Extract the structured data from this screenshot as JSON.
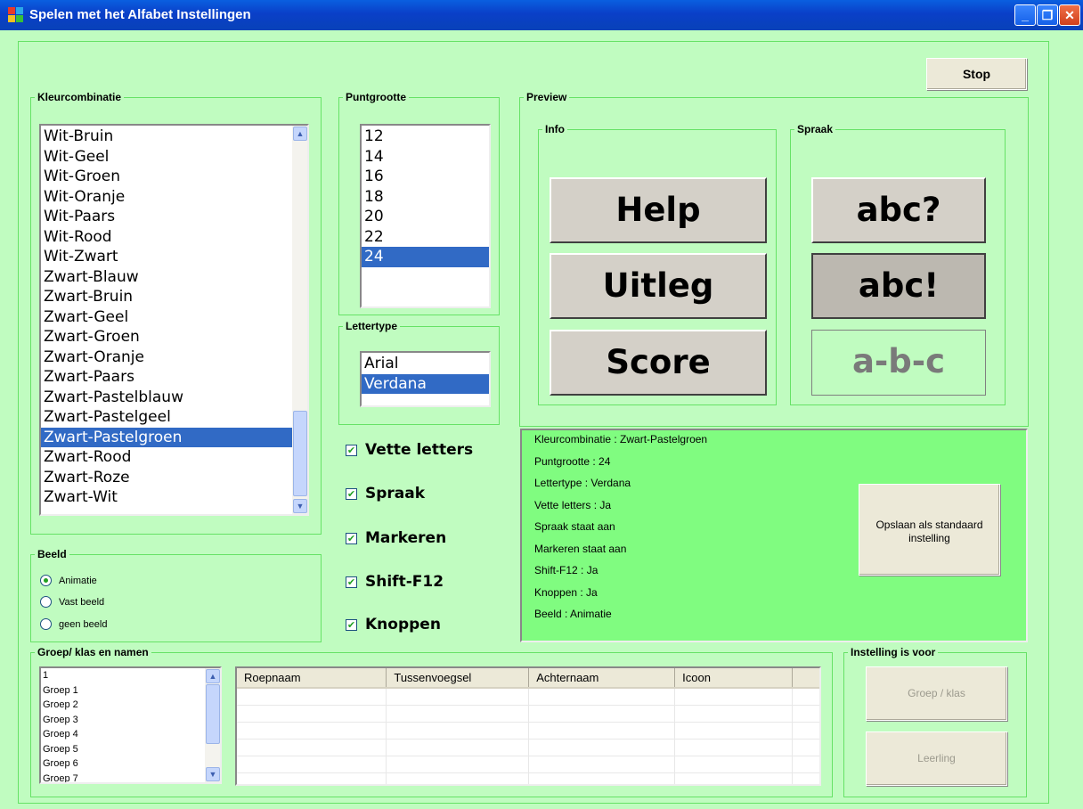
{
  "window": {
    "title": "Spelen met het Alfabet Instellingen",
    "controls": {
      "minimize": "_",
      "restore": "❐",
      "close": "✕"
    }
  },
  "stop_button": "Stop",
  "kleur": {
    "legend": "Kleurcombinatie",
    "items": [
      "Wit-Bruin",
      "Wit-Geel",
      "Wit-Groen",
      "Wit-Oranje",
      "Wit-Paars",
      "Wit-Rood",
      "Wit-Zwart",
      "Zwart-Blauw",
      "Zwart-Bruin",
      "Zwart-Geel",
      "Zwart-Groen",
      "Zwart-Oranje",
      "Zwart-Paars",
      "Zwart-Pastelblauw",
      "Zwart-Pastelgeel",
      "Zwart-Pastelgroen",
      "Zwart-Rood",
      "Zwart-Roze",
      "Zwart-Wit"
    ],
    "selected": "Zwart-Pastelgroen"
  },
  "punt": {
    "legend": "Puntgrootte",
    "items": [
      "12",
      "14",
      "16",
      "18",
      "20",
      "22",
      "24"
    ],
    "selected": "24"
  },
  "letter": {
    "legend": "Lettertype",
    "items": [
      "Arial",
      "Verdana"
    ],
    "selected": "Verdana"
  },
  "checkboxes": [
    {
      "label": "Vette letters",
      "checked": true
    },
    {
      "label": "Spraak",
      "checked": true
    },
    {
      "label": "Markeren",
      "checked": true
    },
    {
      "label": "Shift-F12",
      "checked": true
    },
    {
      "label": "Knoppen",
      "checked": true
    }
  ],
  "beeld": {
    "legend": "Beeld",
    "options": [
      {
        "label": "Animatie",
        "selected": true
      },
      {
        "label": "Vast beeld",
        "selected": false
      },
      {
        "label": "geen beeld",
        "selected": false
      }
    ]
  },
  "preview": {
    "legend": "Preview",
    "info_legend": "Info",
    "spraak_legend": "Spraak",
    "help": "Help",
    "uitleg": "Uitleg",
    "score": "Score",
    "abc_q": "abc?",
    "abc_x": "abc!",
    "abc_dash": "a-b-c"
  },
  "summary": {
    "lines": [
      "Kleurcombinatie : Zwart-Pastelgroen",
      "Puntgrootte : 24",
      "Lettertype : Verdana",
      "Vette letters : Ja",
      "Spraak staat aan",
      "Markeren staat aan",
      "Shift-F12 : Ja",
      "Knoppen : Ja",
      "Beeld : Animatie"
    ],
    "save_button": "Opslaan als standaard instelling"
  },
  "groep": {
    "legend": "Groep/ klas en namen",
    "items": [
      "1",
      "Groep 1",
      "Groep 2",
      "Groep 3",
      "Groep 4",
      "Groep 5",
      "Groep 6",
      "Groep 7"
    ],
    "columns": [
      "Roepnaam",
      "Tussenvoegsel",
      "Achternaam",
      "Icoon"
    ]
  },
  "instelling": {
    "legend": "Instelling is voor",
    "groep_button": "Groep / klas",
    "leerling_button": "Leerling"
  },
  "colors": {
    "background": "#c0fcc0",
    "summary_bg": "#80fc80",
    "selection": "#316ac5"
  }
}
